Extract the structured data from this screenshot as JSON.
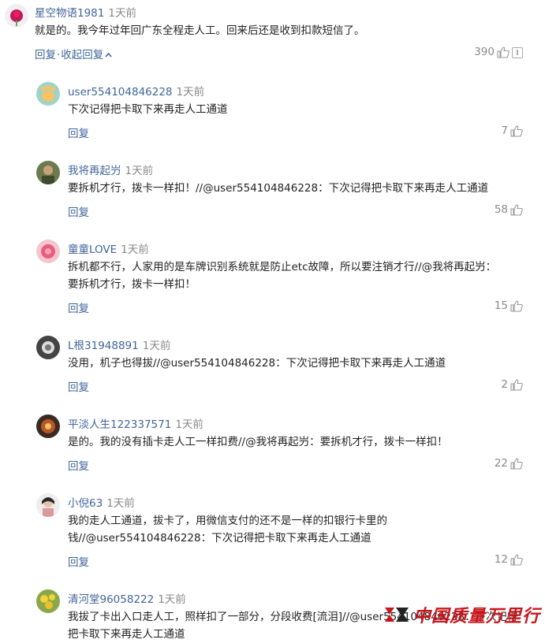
{
  "main": {
    "username": "星空物语1981",
    "time": "1天前",
    "text": "就是的。我今年过年回广东全程走人工。回来后还是收到扣款短信了。",
    "reply_label": "回复",
    "collapse_label": "收起回复",
    "likes": "390"
  },
  "replies": [
    {
      "username": "user554104846228",
      "time": "1天前",
      "text": "下次记得把卡取下来再走人工通道",
      "reply_label": "回复",
      "likes": "7"
    },
    {
      "username": "我将再起屶",
      "time": "1天前",
      "text": "要拆机才行，拨卡一样扣！//@user554104846228：下次记得把卡取下来再走人工通道",
      "reply_label": "回复",
      "likes": "58"
    },
    {
      "username": "童童LOVE",
      "time": "1天前",
      "text": "拆机都不行，人家用的是车牌识别系统就是防止etc故障，所以要注销才行//@我将再起屶：\n要拆机才行，拨卡一样扣！",
      "reply_label": "回复",
      "likes": "15"
    },
    {
      "username": "L根31948891",
      "time": "1天前",
      "text": "没用，机子也得拔//@user554104846228：下次记得把卡取下来再走人工通道",
      "reply_label": "回复",
      "likes": "2"
    },
    {
      "username": "平淡人生122337571",
      "time": "1天前",
      "text": "是的。我的没有插卡走人工一样扣费//@我将再起屶：要拆机才行，拨卡一样扣！",
      "reply_label": "回复",
      "likes": "22"
    },
    {
      "username": "小倪63",
      "time": "1天前",
      "text": "我的走人工通道，拔卡了，用微信支付的还不是一样的扣银行卡里的\n钱//@user554104846228：下次记得把卡取下来再走人工通道",
      "reply_label": "回复",
      "likes": "12"
    },
    {
      "username": "清河堂96058222",
      "time": "1天前",
      "text": "我拔了卡出入口走人工，照样扣了一部分，分段收费[流泪]//@user554104846228：下次记得把卡取下来再走人工通道",
      "reply_label": "回复",
      "likes": ""
    }
  ],
  "watermark": {
    "text": "中国质量万里行"
  },
  "colors": {
    "link": "#406599",
    "muted": "#888888",
    "text": "#222222",
    "watermark": "#c8161d"
  },
  "icons": [
    "thumbs-up-icon",
    "report-icon",
    "chevron-up-icon"
  ]
}
